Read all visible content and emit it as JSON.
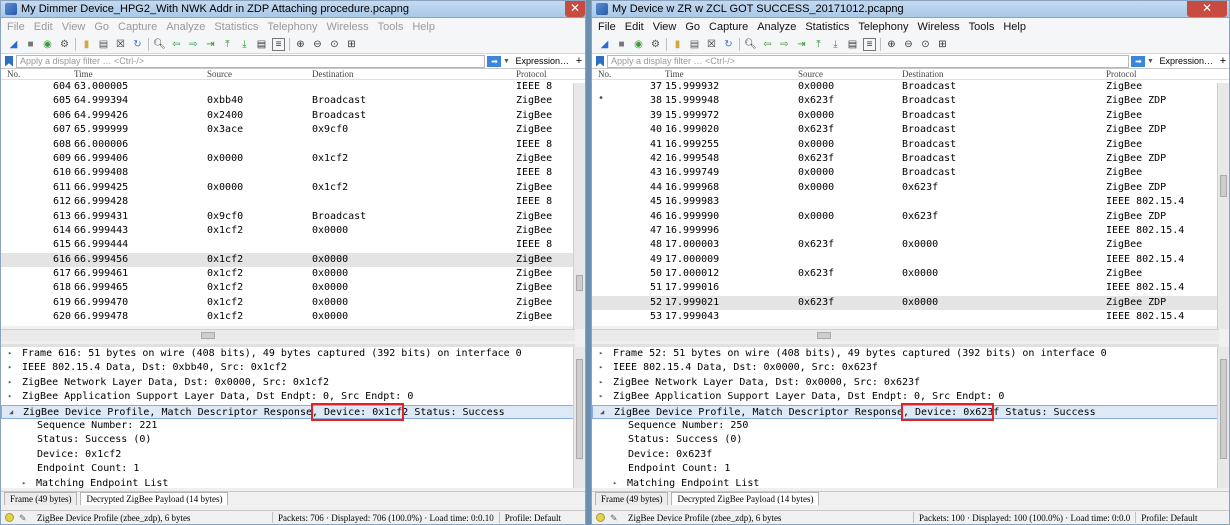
{
  "left": {
    "title": "My Dimmer Device_HPG2_With NWK Addr in ZDP Attaching procedure.pcapng",
    "menu": [
      "File",
      "Edit",
      "View",
      "Go",
      "Capture",
      "Analyze",
      "Statistics",
      "Telephony",
      "Wireless",
      "Tools",
      "Help"
    ],
    "filter_placeholder": "Apply a display filter … <Ctrl-/>",
    "expression_label": "Expression…",
    "plus_label": "+",
    "columns": [
      "No.",
      "Time",
      "Source",
      "Destination",
      "Protocol"
    ],
    "packets": [
      {
        "no": "604",
        "time": "63.000005",
        "src": "",
        "dst": "",
        "proto": "IEEE 8"
      },
      {
        "no": "605",
        "time": "64.999394",
        "src": "0xbb40",
        "dst": "Broadcast",
        "proto": "ZigBee"
      },
      {
        "no": "606",
        "time": "64.999426",
        "src": "0x2400",
        "dst": "Broadcast",
        "proto": "ZigBee"
      },
      {
        "no": "607",
        "time": "65.999999",
        "src": "0x3ace",
        "dst": "0x9cf0",
        "proto": "ZigBee"
      },
      {
        "no": "608",
        "time": "66.000006",
        "src": "",
        "dst": "",
        "proto": "IEEE 8"
      },
      {
        "no": "609",
        "time": "66.999406",
        "src": "0x0000",
        "dst": "0x1cf2",
        "proto": "ZigBee"
      },
      {
        "no": "610",
        "time": "66.999408",
        "src": "",
        "dst": "",
        "proto": "IEEE 8"
      },
      {
        "no": "611",
        "time": "66.999425",
        "src": "0x0000",
        "dst": "0x1cf2",
        "proto": "ZigBee"
      },
      {
        "no": "612",
        "time": "66.999428",
        "src": "",
        "dst": "",
        "proto": "IEEE 8"
      },
      {
        "no": "613",
        "time": "66.999431",
        "src": "0x9cf0",
        "dst": "Broadcast",
        "proto": "ZigBee"
      },
      {
        "no": "614",
        "time": "66.999443",
        "src": "0x1cf2",
        "dst": "0x0000",
        "proto": "ZigBee"
      },
      {
        "no": "615",
        "time": "66.999444",
        "src": "",
        "dst": "",
        "proto": "IEEE 8"
      },
      {
        "no": "616",
        "time": "66.999456",
        "src": "0x1cf2",
        "dst": "0x0000",
        "proto": "ZigBee"
      },
      {
        "no": "617",
        "time": "66.999461",
        "src": "0x1cf2",
        "dst": "0x0000",
        "proto": "ZigBee"
      },
      {
        "no": "618",
        "time": "66.999465",
        "src": "0x1cf2",
        "dst": "0x0000",
        "proto": "ZigBee"
      },
      {
        "no": "619",
        "time": "66.999470",
        "src": "0x1cf2",
        "dst": "0x0000",
        "proto": "ZigBee"
      },
      {
        "no": "620",
        "time": "66.999478",
        "src": "0x1cf2",
        "dst": "0x0000",
        "proto": "ZigBee"
      }
    ],
    "details": [
      {
        "arrow": "▸",
        "text": "Frame 616: 51 bytes on wire (408 bits), 49 bytes captured (392 bits) on interface 0"
      },
      {
        "arrow": "▸",
        "text": "IEEE 802.15.4 Data, Dst: 0xbb40, Src: 0x1cf2"
      },
      {
        "arrow": "▸",
        "text": "ZigBee Network Layer Data, Dst: 0x0000, Src: 0x1cf2"
      },
      {
        "arrow": "▸",
        "text": "ZigBee Application Support Layer Data, Dst Endpt: 0, Src Endpt: 0"
      },
      {
        "arrow": "◢",
        "text": "ZigBee Device Profile, Match Descriptor Response, Device: 0x1cf2  Status: Success"
      },
      {
        "arrow": "",
        "text": "Sequence Number: 221"
      },
      {
        "arrow": "",
        "text": "Status: Success (0)"
      },
      {
        "arrow": "",
        "text": "Device: 0x1cf2"
      },
      {
        "arrow": "",
        "text": "Endpoint Count: 1"
      },
      {
        "arrow": "▸",
        "text": "Matching Endpoint List"
      }
    ],
    "tabs": [
      "Frame (49 bytes)",
      "Decrypted ZigBee Payload (14 bytes)"
    ],
    "status": {
      "profile_text": "ZigBee Device Profile (zbee_zdp), 6 bytes",
      "packets_text": "Packets: 706 · Displayed: 706 (100.0%) · Load time: 0:0.10",
      "profile": "Profile: Default"
    }
  },
  "right": {
    "title": "My Device w ZR w ZCL GOT SUCCESS_20171012.pcapng",
    "menu": [
      "File",
      "Edit",
      "View",
      "Go",
      "Capture",
      "Analyze",
      "Statistics",
      "Telephony",
      "Wireless",
      "Tools",
      "Help"
    ],
    "filter_placeholder": "Apply a display filter … <Ctrl-/>",
    "expression_label": "Expression…",
    "plus_label": "+",
    "columns": [
      "No.",
      "Time",
      "Source",
      "Destination",
      "Protocol"
    ],
    "packets": [
      {
        "no": "37",
        "time": "15.999932",
        "src": "0x0000",
        "dst": "Broadcast",
        "proto": "ZigBee"
      },
      {
        "no": "38",
        "time": "15.999948",
        "src": "0x623f",
        "dst": "Broadcast",
        "proto": "ZigBee ZDP"
      },
      {
        "no": "39",
        "time": "15.999972",
        "src": "0x0000",
        "dst": "Broadcast",
        "proto": "ZigBee"
      },
      {
        "no": "40",
        "time": "16.999020",
        "src": "0x623f",
        "dst": "Broadcast",
        "proto": "ZigBee ZDP"
      },
      {
        "no": "41",
        "time": "16.999255",
        "src": "0x0000",
        "dst": "Broadcast",
        "proto": "ZigBee"
      },
      {
        "no": "42",
        "time": "16.999548",
        "src": "0x623f",
        "dst": "Broadcast",
        "proto": "ZigBee ZDP"
      },
      {
        "no": "43",
        "time": "16.999749",
        "src": "0x0000",
        "dst": "Broadcast",
        "proto": "ZigBee"
      },
      {
        "no": "44",
        "time": "16.999968",
        "src": "0x0000",
        "dst": "0x623f",
        "proto": "ZigBee ZDP"
      },
      {
        "no": "45",
        "time": "16.999983",
        "src": "",
        "dst": "",
        "proto": "IEEE 802.15.4"
      },
      {
        "no": "46",
        "time": "16.999990",
        "src": "0x0000",
        "dst": "0x623f",
        "proto": "ZigBee ZDP"
      },
      {
        "no": "47",
        "time": "16.999996",
        "src": "",
        "dst": "",
        "proto": "IEEE 802.15.4"
      },
      {
        "no": "48",
        "time": "17.000003",
        "src": "0x623f",
        "dst": "0x0000",
        "proto": "ZigBee"
      },
      {
        "no": "49",
        "time": "17.000009",
        "src": "",
        "dst": "",
        "proto": "IEEE 802.15.4"
      },
      {
        "no": "50",
        "time": "17.000012",
        "src": "0x623f",
        "dst": "0x0000",
        "proto": "ZigBee"
      },
      {
        "no": "51",
        "time": "17.999016",
        "src": "",
        "dst": "",
        "proto": "IEEE 802.15.4"
      },
      {
        "no": "52",
        "time": "17.999021",
        "src": "0x623f",
        "dst": "0x0000",
        "proto": "ZigBee ZDP"
      },
      {
        "no": "53",
        "time": "17.999043",
        "src": "",
        "dst": "",
        "proto": "IEEE 802.15.4"
      }
    ],
    "details": [
      {
        "arrow": "▸",
        "text": "Frame 52: 51 bytes on wire (408 bits), 49 bytes captured (392 bits) on interface 0"
      },
      {
        "arrow": "▸",
        "text": "IEEE 802.15.4 Data, Dst: 0x0000, Src: 0x623f"
      },
      {
        "arrow": "▸",
        "text": "ZigBee Network Layer Data, Dst: 0x0000, Src: 0x623f"
      },
      {
        "arrow": "▸",
        "text": "ZigBee Application Support Layer Data, Dst Endpt: 0, Src Endpt: 0"
      },
      {
        "arrow": "◢",
        "text": "ZigBee Device Profile, Match Descriptor Response, Device: 0x623f  Status: Success"
      },
      {
        "arrow": "",
        "text": "Sequence Number: 250"
      },
      {
        "arrow": "",
        "text": "Status: Success (0)"
      },
      {
        "arrow": "",
        "text": "Device: 0x623f"
      },
      {
        "arrow": "",
        "text": "Endpoint Count: 1"
      },
      {
        "arrow": "▸",
        "text": "Matching Endpoint List"
      }
    ],
    "tabs": [
      "Frame (49 bytes)",
      "Decrypted ZigBee Payload (14 bytes)"
    ],
    "status": {
      "profile_text": "ZigBee Device Profile (zbee_zdp), 6 bytes",
      "packets_text": "Packets: 100 · Displayed: 100 (100.0%) · Load time: 0:0.0",
      "profile": "Profile: Default"
    }
  },
  "colors": {
    "highlight_box": "#e32222",
    "selected_detail": "#dde9f7",
    "selected_row": "#e4e4e4"
  }
}
